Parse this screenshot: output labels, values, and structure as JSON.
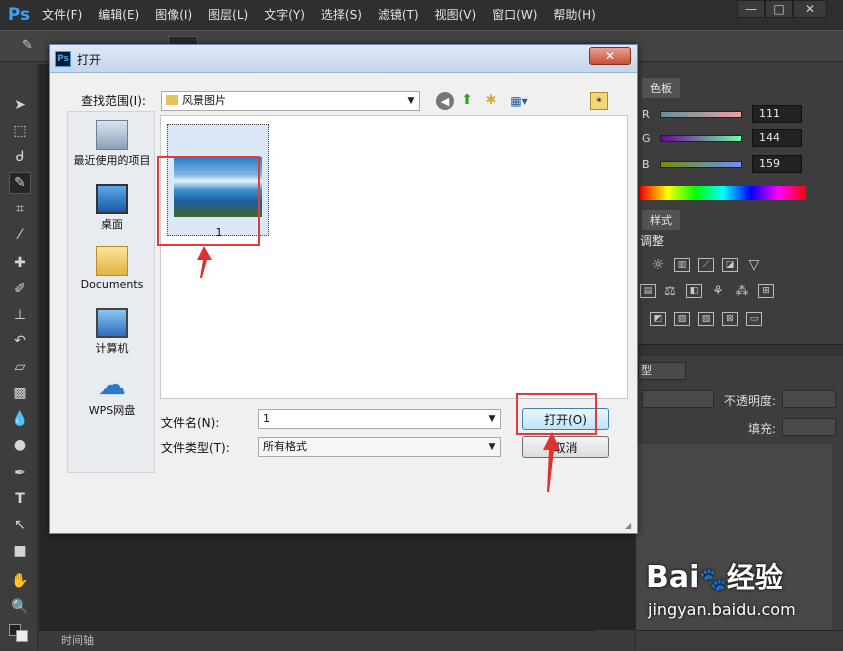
{
  "app": {
    "logo": "Ps",
    "menus": [
      "文件(F)",
      "编辑(E)",
      "图像(I)",
      "图层(L)",
      "文字(Y)",
      "选择(S)",
      "滤镜(T)",
      "视图(V)",
      "窗口(W)",
      "帮助(H)"
    ]
  },
  "window_controls": {
    "minimize": "—",
    "maximize": "□",
    "close": "✕"
  },
  "timeline_label": "时间轴",
  "right_panel": {
    "color_tab": "色板",
    "sliders": [
      {
        "label": "R",
        "value": "111"
      },
      {
        "label": "G",
        "value": "144"
      },
      {
        "label": "B",
        "value": "159"
      }
    ],
    "style_tab": "样式",
    "adjust_title": "调整",
    "layers_kind": "型",
    "opacity_label": "不透明度:",
    "fill_label": "填充:"
  },
  "dialog": {
    "title": "打开",
    "close_label": "✕",
    "lookin_label": "查找范围(I):",
    "lookin_value": "风景图片",
    "places": [
      {
        "label": "最近使用的项目",
        "icon": "recent-icon"
      },
      {
        "label": "桌面",
        "icon": "desktop-icon"
      },
      {
        "label": "Documents",
        "icon": "folder-icon"
      },
      {
        "label": "计算机",
        "icon": "computer-icon"
      },
      {
        "label": "WPS网盘",
        "icon": "cloud-icon"
      }
    ],
    "file": {
      "name": "1"
    },
    "filename_label": "文件名(N):",
    "filename_value": "1",
    "filetype_label": "文件类型(T):",
    "filetype_value": "所有格式",
    "open_button": "打开(O)",
    "cancel_button": "取消"
  },
  "watermark": {
    "brand": "Bai",
    "brand2": "经验",
    "url": "jingyan.baidu.com"
  }
}
